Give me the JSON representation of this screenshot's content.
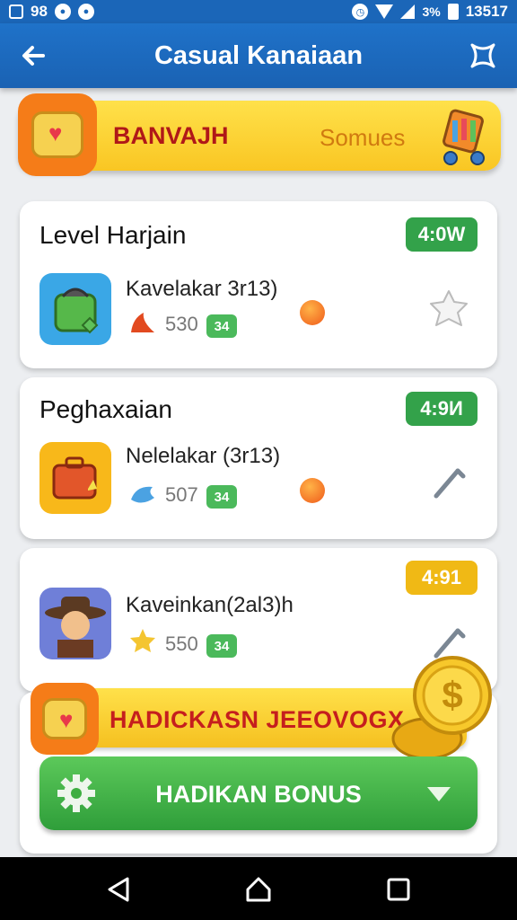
{
  "status_bar": {
    "left": "98",
    "right": "13517",
    "battery_pct": "3%"
  },
  "app_bar": {
    "title": "Casual Kanaiaan",
    "back_icon": "arrow-left-icon",
    "close_icon": "close-x-icon"
  },
  "banner": {
    "title": "BANVAJH",
    "subtitle": "Somues"
  },
  "cards": [
    {
      "title": "Level Harjain",
      "time": "4:0W",
      "item_name": "Kavelakar 3r13)",
      "stat_value": "530",
      "stat_badge": "34",
      "time_color": "#33a24a"
    },
    {
      "title": "Peghaxaian",
      "time": "4:9И",
      "item_name": "Nelelakar (3r13)",
      "stat_value": "507",
      "stat_badge": "34",
      "time_color": "#33a24a"
    },
    {
      "title": "",
      "time": "4:91",
      "item_name": "Kaveinkan(2al3)h",
      "stat_value": "550",
      "stat_badge": "34",
      "time_color": "#f0b915"
    }
  ],
  "bonus": {
    "ribbon": "HADICKASN JEEOVOGX",
    "button_label": "HADIKAN BONUS"
  }
}
